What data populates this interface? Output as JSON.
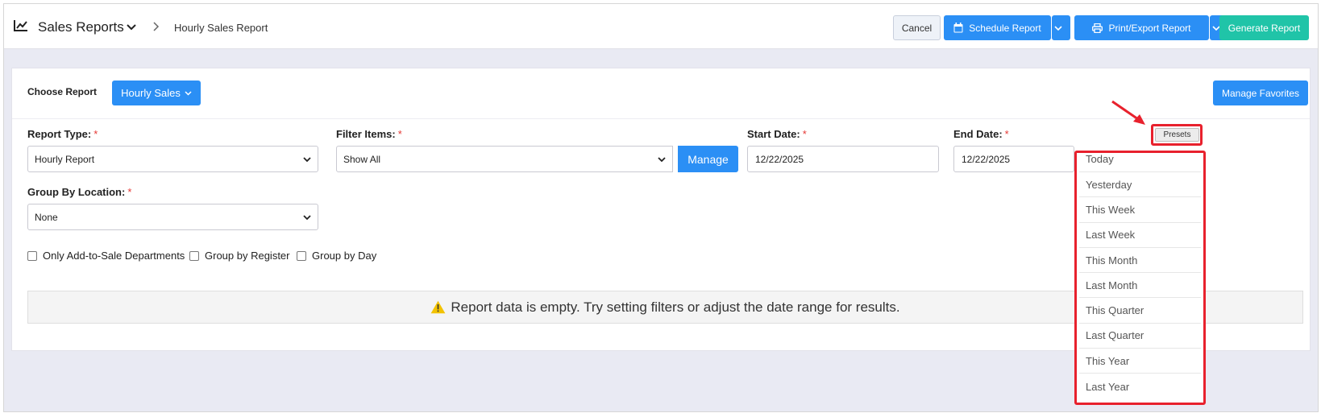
{
  "header": {
    "app_title": "Sales Reports",
    "breadcrumb": "Hourly Sales Report",
    "cancel_label": "Cancel",
    "schedule_label": "Schedule Report",
    "print_label": "Print/Export Report",
    "generate_label": "Generate Report"
  },
  "report_picker": {
    "choose_label": "Choose Report",
    "selected_report": "Hourly Sales",
    "favorites_label": "Manage Favorites"
  },
  "filters": {
    "report_type_label": "Report Type:",
    "report_type_value": "Hourly Report",
    "filter_items_label": "Filter Items:",
    "filter_items_value": "Show All",
    "manage_label": "Manage",
    "start_date_label": "Start Date:",
    "start_date_value": "12/22/2025",
    "end_date_label": "End Date:",
    "end_date_value": "12/22/2025",
    "group_location_label": "Group By Location:",
    "group_location_value": "None",
    "required_mark": "*"
  },
  "options": {
    "add_to_sale_label": "Only Add-to-Sale Departments",
    "group_register_label": "Group by Register",
    "group_day_label": "Group by Day"
  },
  "empty_message": "Report data is empty. Try setting filters or adjust the date range for results.",
  "presets": {
    "button_label": "Presets",
    "items": [
      "Today",
      "Yesterday",
      "This Week",
      "Last Week",
      "This Month",
      "Last Month",
      "This Quarter",
      "Last Quarter",
      "This Year",
      "Last Year"
    ]
  },
  "colors": {
    "primary": "#2b8ff5",
    "success": "#20c4a8",
    "highlight": "#e8212d",
    "warning": "#f2c200"
  },
  "icons": {
    "brand": "line-chart-icon",
    "schedule": "calendar-icon",
    "print": "printer-icon",
    "empty": "warning-icon"
  }
}
